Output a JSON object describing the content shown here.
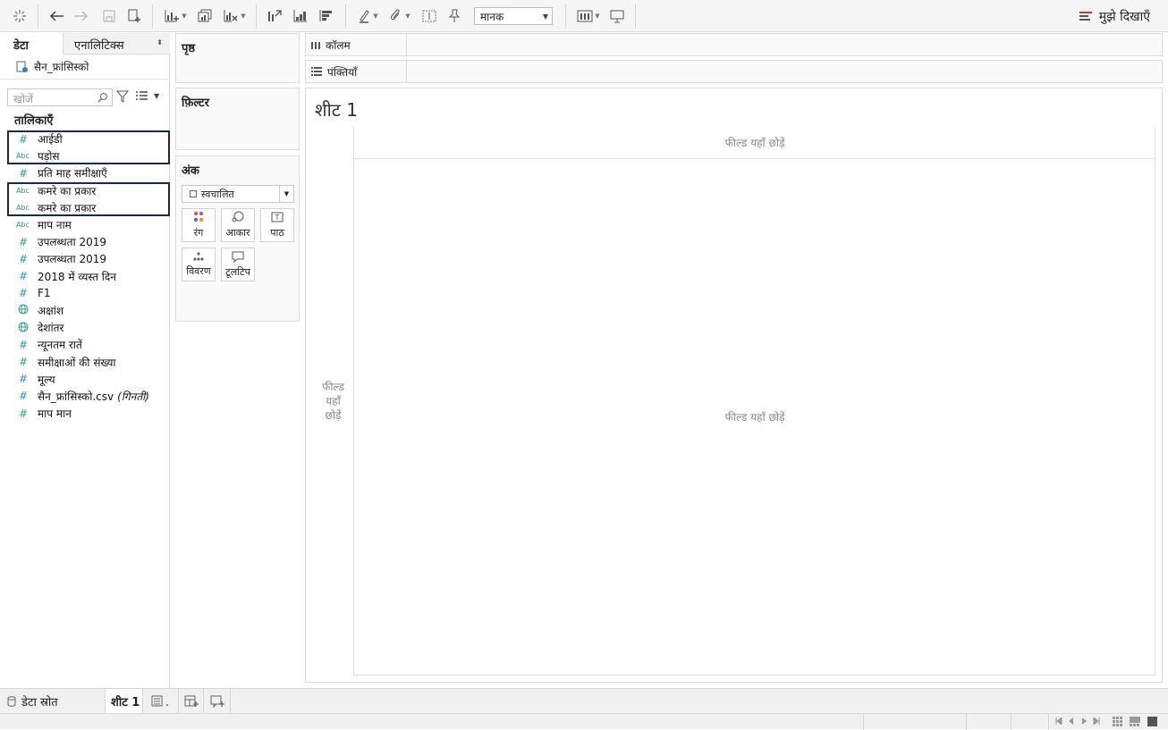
{
  "toolbar": {
    "view_select": "मानक",
    "show_me_label": "मुझे दिखाएँ"
  },
  "data_pane": {
    "tab_data": "डेटा",
    "tab_analytics": "एनालिटिक्स",
    "datasource": "सैन_फ्रांसिस्को",
    "search_placeholder": "खोजें",
    "tables_heading": "तालिकाएँ",
    "fields": [
      {
        "type": "number",
        "name": "आईडी"
      },
      {
        "type": "text",
        "name": "पड़ोस"
      },
      {
        "type": "number",
        "name": "प्रति माह समीक्षाएँ"
      },
      {
        "type": "text",
        "name": "कमरे का प्रकार"
      },
      {
        "type": "text",
        "name": "कमरे का प्रकार"
      },
      {
        "type": "text",
        "name": "माप नाम"
      },
      {
        "type": "number",
        "name": "उपलब्धता 2019"
      },
      {
        "type": "number",
        "name": "उपलब्धता 2019"
      },
      {
        "type": "number",
        "name": "2018 में व्यस्त दिन"
      },
      {
        "type": "number",
        "name": "F1"
      },
      {
        "type": "geo",
        "name": "अक्षांश"
      },
      {
        "type": "geo",
        "name": "देशांतर"
      },
      {
        "type": "number",
        "name": "न्यूनतम रातें"
      },
      {
        "type": "number",
        "name": "समीक्षाओं की संख्या"
      },
      {
        "type": "number",
        "name": "मूल्य"
      },
      {
        "type": "number",
        "name": "सैन_फ्रांसिस्को.csv",
        "suffix": "(गिनती)"
      },
      {
        "type": "number",
        "name": "माप मान"
      }
    ],
    "type_labels": {
      "text": "Abc",
      "number": "#"
    }
  },
  "shelves": {
    "pages": "पृष्ठ",
    "filters": "फ़िल्टर",
    "marks": "अंक",
    "marks_type": "स्वचालित",
    "marks_buttons": [
      "रंग",
      "आकार",
      "पाठ",
      "विवरण",
      "टूलटिप"
    ],
    "columns": "कॉलम",
    "rows": "पंक्तियाँ"
  },
  "canvas": {
    "sheet_title": "शीट 1",
    "drop_top": "फील्ड यहाँ छोड़ें",
    "drop_left": "फील्ड यहाँ छोड़ें",
    "drop_main": "फील्ड यहाँ छोड़ें"
  },
  "bottom_tabs": {
    "data_source": "डेटा स्रोत",
    "sheet1": "शीट 1"
  },
  "colors": {
    "accent": "#3a9a9a",
    "selection_border": "#1a2a44"
  }
}
